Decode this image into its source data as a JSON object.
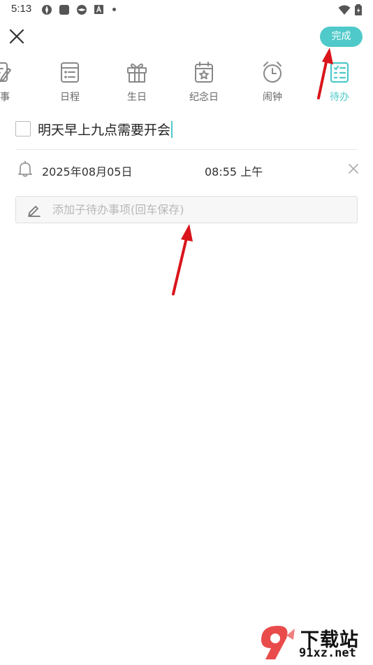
{
  "status_bar": {
    "time": "5:13"
  },
  "header": {
    "done_label": "完成"
  },
  "tabs": [
    {
      "label": "记事",
      "icon": "notes-icon"
    },
    {
      "label": "日程",
      "icon": "schedule-icon"
    },
    {
      "label": "生日",
      "icon": "gift-icon"
    },
    {
      "label": "纪念日",
      "icon": "anniversary-icon"
    },
    {
      "label": "闹钟",
      "icon": "alarm-icon"
    },
    {
      "label": "待办",
      "icon": "todo-icon",
      "active": true
    }
  ],
  "todo": {
    "title": "明天早上九点需要开会",
    "checked": false
  },
  "reminder": {
    "date": "2025年08月05日",
    "time": "08:55 上午"
  },
  "subtask": {
    "placeholder": "添加子待办事项(回车保存)",
    "value": ""
  },
  "colors": {
    "accent": "#4fc9c9",
    "arrow": "#d9151b"
  },
  "watermark": {
    "text": "下载站",
    "url": "91xz.net"
  }
}
